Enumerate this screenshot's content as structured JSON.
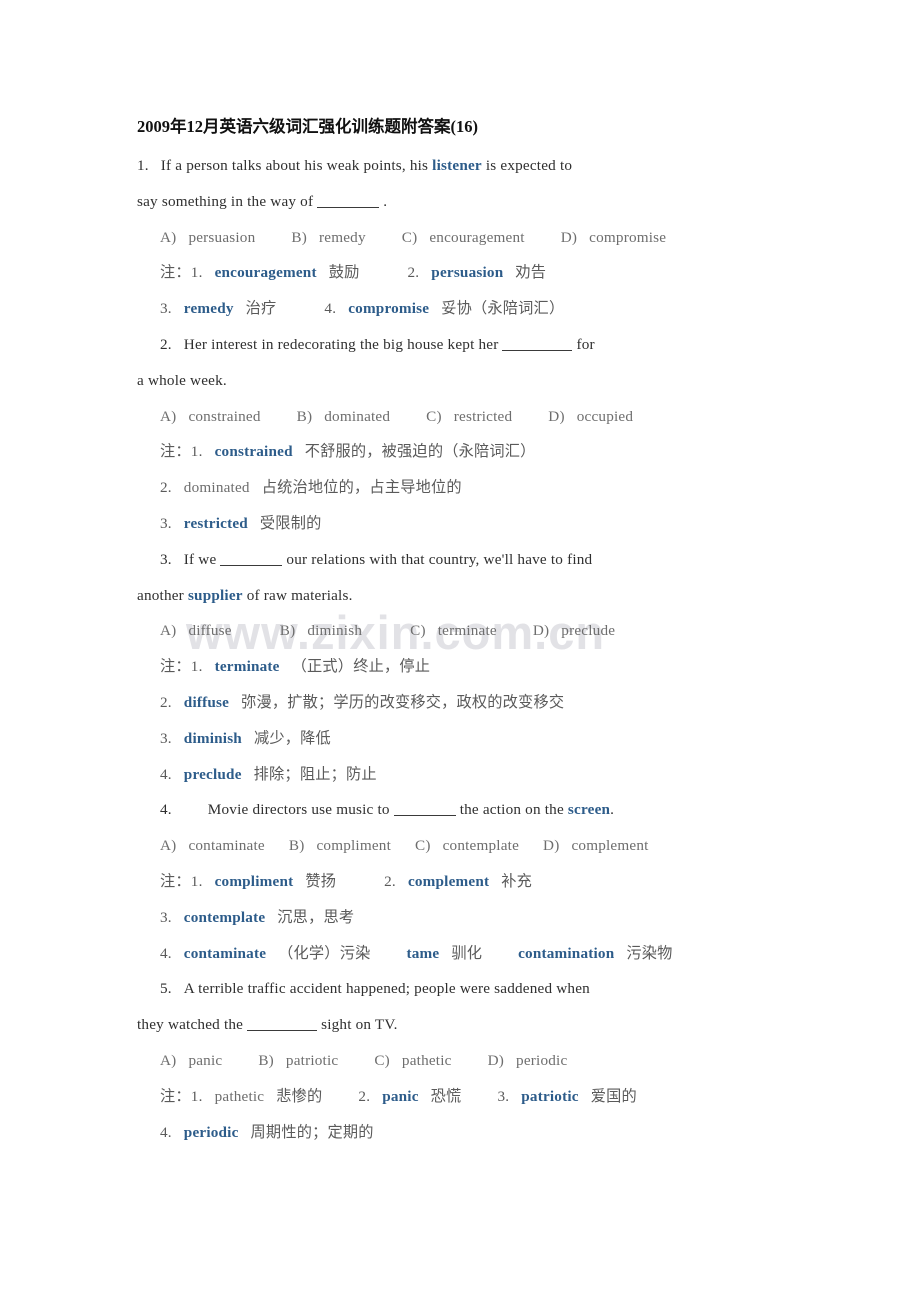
{
  "document": {
    "title": "2009年12月英语六级词汇强化训练题附答案(16)",
    "watermark": "www.zixin.com.cn",
    "note_label": "注：",
    "colors": {
      "highlight_blue": "#2d5c8a",
      "body_text": "#3a3a3a",
      "option_text": "#6e6e6e",
      "title_text": "#111111",
      "watermark": "#e2e2e6",
      "background": "#ffffff"
    }
  },
  "questions": [
    {
      "number": "1.",
      "stem_line1_a": "If a person talks about his weak points, his ",
      "stem_line1_blue": "listener",
      "stem_line1_b": " is expected to",
      "stem_line2_a": "say something in the way of ",
      "stem_line2_b": " .",
      "options": [
        {
          "letter": "A)",
          "text": "persuasion"
        },
        {
          "letter": "B)",
          "text": "remedy"
        },
        {
          "letter": "C)",
          "text": "encouragement"
        },
        {
          "letter": "D)",
          "text": "compromise"
        }
      ],
      "notes_line1": {
        "n1_index": "1.",
        "n1_word": "encouragement",
        "n1_gloss": "鼓励",
        "n2_index": "2.",
        "n2_word": "persuasion",
        "n2_gloss": "劝告"
      },
      "notes_line2": {
        "n3_index": "3.",
        "n3_word": "remedy",
        "n3_gloss": "治疗",
        "n4_index": "4.",
        "n4_word": "compromise",
        "n4_gloss": "妥协（永陪词汇）"
      }
    },
    {
      "number": "2.",
      "stem_line1": "Her interest in redecorating the big house kept her ",
      "stem_line1_tail": " for",
      "stem_line2": "a whole week.",
      "options": [
        {
          "letter": "A)",
          "text": "constrained"
        },
        {
          "letter": "B)",
          "text": "dominated"
        },
        {
          "letter": "C)",
          "text": "restricted"
        },
        {
          "letter": "D)",
          "text": "occupied"
        }
      ],
      "notes": [
        {
          "index": "1.",
          "word": "constrained",
          "word_blue": true,
          "gloss": "不舒服的，被强迫的（永陪词汇）",
          "has_label": true
        },
        {
          "index": "2.",
          "word": "dominated",
          "word_blue": false,
          "gloss": "占统治地位的，占主导地位的",
          "has_label": false
        },
        {
          "index": "3.",
          "word": "restricted",
          "word_blue": true,
          "gloss": "受限制的",
          "has_label": false
        }
      ]
    },
    {
      "number": "3.",
      "stem_line1_a": "If we ",
      "stem_line1_b": " our relations with that country, we'll have to find",
      "stem_line2_a": "another ",
      "stem_line2_blue": "supplier",
      "stem_line2_b": " of raw materials.",
      "options": [
        {
          "letter": "A)",
          "text": "diffuse"
        },
        {
          "letter": "B)",
          "text": "diminish"
        },
        {
          "letter": "C)",
          "text": "terminate"
        },
        {
          "letter": "D)",
          "text": "preclude"
        }
      ],
      "notes": [
        {
          "index": "1.",
          "word": "terminate",
          "word_blue": true,
          "gloss": "（正式）终止，停止",
          "has_label": true
        },
        {
          "index": "2.",
          "word": "diffuse",
          "word_blue": true,
          "gloss": "弥漫，扩散；学历的改变移交，政权的改变移交",
          "has_label": false
        },
        {
          "index": "3.",
          "word": "diminish",
          "word_blue": true,
          "gloss": "减少，降低",
          "has_label": false
        },
        {
          "index": "4.",
          "word": "preclude",
          "word_blue": true,
          "gloss": "排除；阻止；防止",
          "has_label": false
        }
      ]
    },
    {
      "number": "4.",
      "stem_line1_a": "Movie directors use music to ",
      "stem_line1_b": " the action on the ",
      "stem_line1_blue": "screen",
      "stem_line1_c": ".",
      "options": [
        {
          "letter": "A)",
          "text": "contaminate"
        },
        {
          "letter": "B)",
          "text": "compliment"
        },
        {
          "letter": "C)",
          "text": "contemplate"
        },
        {
          "letter": "D)",
          "text": "complement"
        }
      ],
      "notes_line1": {
        "n1_index": "1.",
        "n1_word": "compliment",
        "n1_gloss": "赞扬",
        "n2_index": "2.",
        "n2_word": "complement",
        "n2_gloss": "补充"
      },
      "notes_line2": {
        "index": "3.",
        "word": "contemplate",
        "gloss": "沉思，思考"
      },
      "notes_line3": {
        "index": "4.",
        "word": "contaminate",
        "gloss": "（化学）污染",
        "extra1_word": "tame",
        "extra1_gloss": "驯化",
        "extra2_word": "contamination",
        "extra2_gloss": "污染物"
      }
    },
    {
      "number": "5.",
      "stem_line1": "A terrible traffic accident happened; people were saddened when",
      "stem_line2_a": "they watched the ",
      "stem_line2_b": " sight on TV.",
      "options": [
        {
          "letter": "A)",
          "text": "panic"
        },
        {
          "letter": "B)",
          "text": "patriotic"
        },
        {
          "letter": "C)",
          "text": "pathetic"
        },
        {
          "letter": "D)",
          "text": "periodic"
        }
      ],
      "notes_line1": {
        "n1_index": "1.",
        "n1_word": "pathetic",
        "n1_blue": false,
        "n1_gloss": "悲惨的",
        "n2_index": "2.",
        "n2_word": "panic",
        "n2_gloss": "恐慌",
        "n3_index": "3.",
        "n3_word": "patriotic",
        "n3_gloss": "爱国的"
      },
      "notes_line2": {
        "index": "4.",
        "word": "periodic",
        "gloss": "周期性的；定期的"
      }
    }
  ]
}
